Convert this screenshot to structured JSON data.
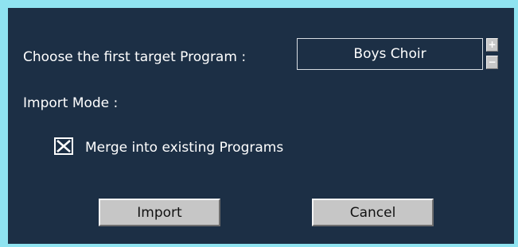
{
  "dialog": {
    "target_label": "Choose the first target Program :",
    "program_value": "Boys Choir",
    "spin_up": "+",
    "spin_down": "−",
    "import_mode_label": "Import Mode :",
    "merge_label": "Merge into existing Programs",
    "merge_checked": true,
    "import_button": "Import",
    "cancel_button": "Cancel"
  },
  "colors": {
    "background": "#1c2f45",
    "frame": "#8fe3f0",
    "button_face": "#c6c6c6"
  }
}
